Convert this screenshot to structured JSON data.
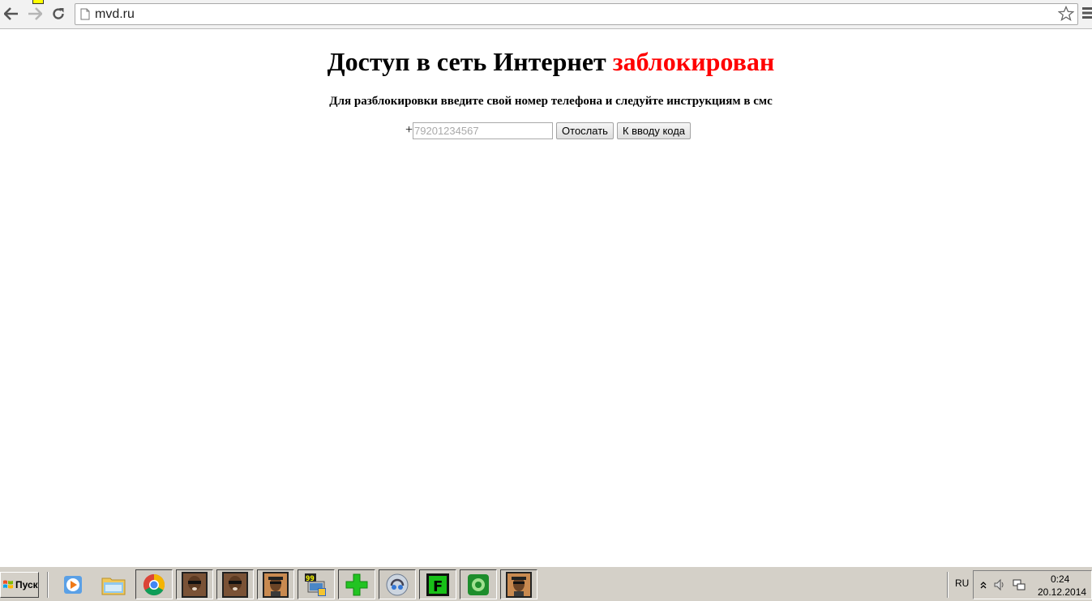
{
  "browser": {
    "url": "mvd.ru",
    "icons": {
      "back": "back-arrow-icon",
      "forward": "forward-arrow-icon",
      "reload": "reload-icon",
      "page": "page-icon",
      "bookmark": "star-icon",
      "menu": "hamburger-menu-icon"
    }
  },
  "page": {
    "title_main": "Доступ в сеть Интернет ",
    "title_highlight": "заблокирован",
    "title_highlight_color": "#ff0000",
    "subtitle": "Для разблокировки введите свой номер телефона и следуйте инструкциям в смс",
    "phone_prefix": "+",
    "phone_placeholder": "79201234567",
    "phone_value": "",
    "send_button": "Отослать",
    "code_button": "К вводу кода"
  },
  "taskbar": {
    "start_label": "Пуск",
    "apps": [
      {
        "name": "media-player-icon"
      },
      {
        "name": "file-explorer-icon"
      },
      {
        "name": "chrome-icon"
      },
      {
        "name": "gta-sa-character-icon-1"
      },
      {
        "name": "gta-sa-character-icon-2"
      },
      {
        "name": "gta-sa-character-icon-3"
      },
      {
        "name": "computer-99-icon"
      },
      {
        "name": "green-plus-icon"
      },
      {
        "name": "teamspeak-icon"
      },
      {
        "name": "green-f-icon"
      },
      {
        "name": "green-square-app-icon"
      },
      {
        "name": "gta-sa-character-icon-4"
      }
    ],
    "language": "RU",
    "time": "0:24",
    "date": "20.12.2014"
  }
}
